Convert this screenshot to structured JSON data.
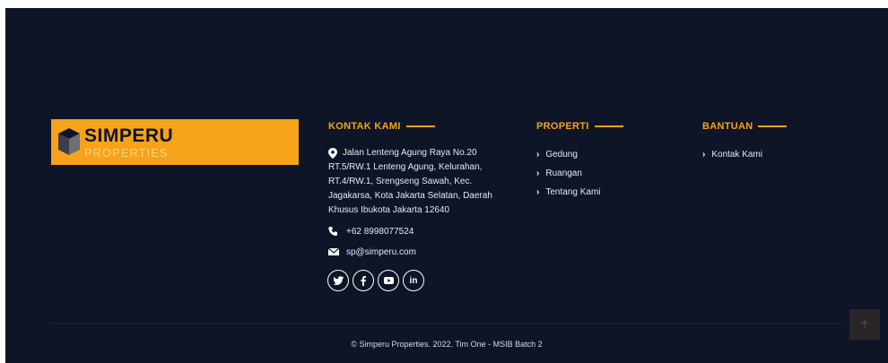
{
  "logo": {
    "title": "SIMPERU",
    "subtitle": "PROPERTIES",
    "accent_color": "#f7a21b"
  },
  "contact": {
    "heading": "KONTAK KAMI",
    "address": "Jalan Lenteng Agung Raya No.20 RT.5/RW.1 Lenteng Agung, Kelurahan, RT.4/RW.1, Srengseng Sawah, Kec. Jagakarsa, Kota Jakarta Selatan, Daerah Khusus Ibukota Jakarta 12640",
    "phone": "+62 8998077524",
    "email": "sp@simperu.com",
    "social_icons": [
      "twitter-icon",
      "facebook-icon",
      "youtube-icon",
      "linkedin-icon"
    ]
  },
  "properti": {
    "heading": "PROPERTI",
    "links": [
      "Gedung",
      "Ruangan",
      "Tentang Kami"
    ]
  },
  "bantuan": {
    "heading": "BANTUAN",
    "links": [
      "Kontak Kami"
    ]
  },
  "copyright": "© Simperu Properties. 2022. Tim One - MSIB Batch 2",
  "colors": {
    "background": "#0e1526",
    "accent": "#f7a21b"
  }
}
